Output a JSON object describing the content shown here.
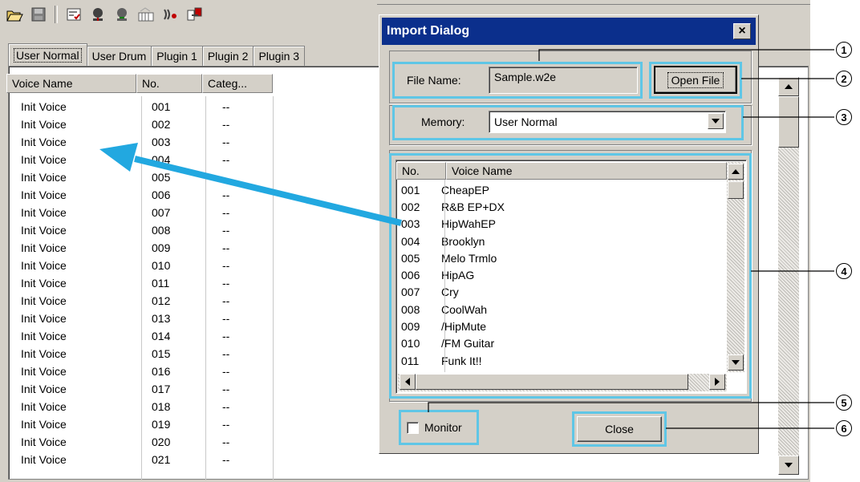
{
  "tabs": [
    "User Normal",
    "User Drum",
    "Plugin 1",
    "Plugin 2",
    "Plugin 3"
  ],
  "main_list": {
    "columns": [
      "Voice Name",
      "No.",
      "Categ..."
    ],
    "rows": [
      [
        "Init Voice",
        "001",
        "--"
      ],
      [
        "Init Voice",
        "002",
        "--"
      ],
      [
        "Init Voice",
        "003",
        "--"
      ],
      [
        "Init Voice",
        "004",
        "--"
      ],
      [
        "Init Voice",
        "005",
        ""
      ],
      [
        "Init Voice",
        "006",
        "--"
      ],
      [
        "Init Voice",
        "007",
        "--"
      ],
      [
        "Init Voice",
        "008",
        "--"
      ],
      [
        "Init Voice",
        "009",
        "--"
      ],
      [
        "Init Voice",
        "010",
        "--"
      ],
      [
        "Init Voice",
        "011",
        "--"
      ],
      [
        "Init Voice",
        "012",
        "--"
      ],
      [
        "Init Voice",
        "013",
        "--"
      ],
      [
        "Init Voice",
        "014",
        "--"
      ],
      [
        "Init Voice",
        "015",
        "--"
      ],
      [
        "Init Voice",
        "016",
        "--"
      ],
      [
        "Init Voice",
        "017",
        "--"
      ],
      [
        "Init Voice",
        "018",
        "--"
      ],
      [
        "Init Voice",
        "019",
        "--"
      ],
      [
        "Init Voice",
        "020",
        "--"
      ],
      [
        "Init Voice",
        "021",
        "--"
      ]
    ]
  },
  "dialog": {
    "title": "Import Dialog",
    "close_x": "×",
    "file_name_label": "File Name:",
    "file_name_value": "Sample.w2e",
    "open_file_label": "Open File",
    "memory_label": "Memory:",
    "memory_value": "User Normal",
    "list_columns": [
      "No.",
      "Voice Name"
    ],
    "list_rows": [
      [
        "001",
        "CheapEP"
      ],
      [
        "002",
        "R&B EP+DX"
      ],
      [
        "003",
        "HipWahEP"
      ],
      [
        "004",
        "Brooklyn"
      ],
      [
        "005",
        "Melo Trmlo"
      ],
      [
        "006",
        "HipAG"
      ],
      [
        "007",
        "Cry"
      ],
      [
        "008",
        "CoolWah"
      ],
      [
        "009",
        "/HipMute"
      ],
      [
        "010",
        "/FM Guitar"
      ],
      [
        "011",
        "Funk It!!"
      ]
    ],
    "monitor_label": "Monitor",
    "monitor_checked": false,
    "close_label": "Close"
  },
  "callouts": [
    "1",
    "2",
    "3",
    "4",
    "5",
    "6"
  ],
  "colors": {
    "highlight": "#5fc6e6",
    "titlebar": "#0b2f8c",
    "arrow": "#22a8e0"
  }
}
